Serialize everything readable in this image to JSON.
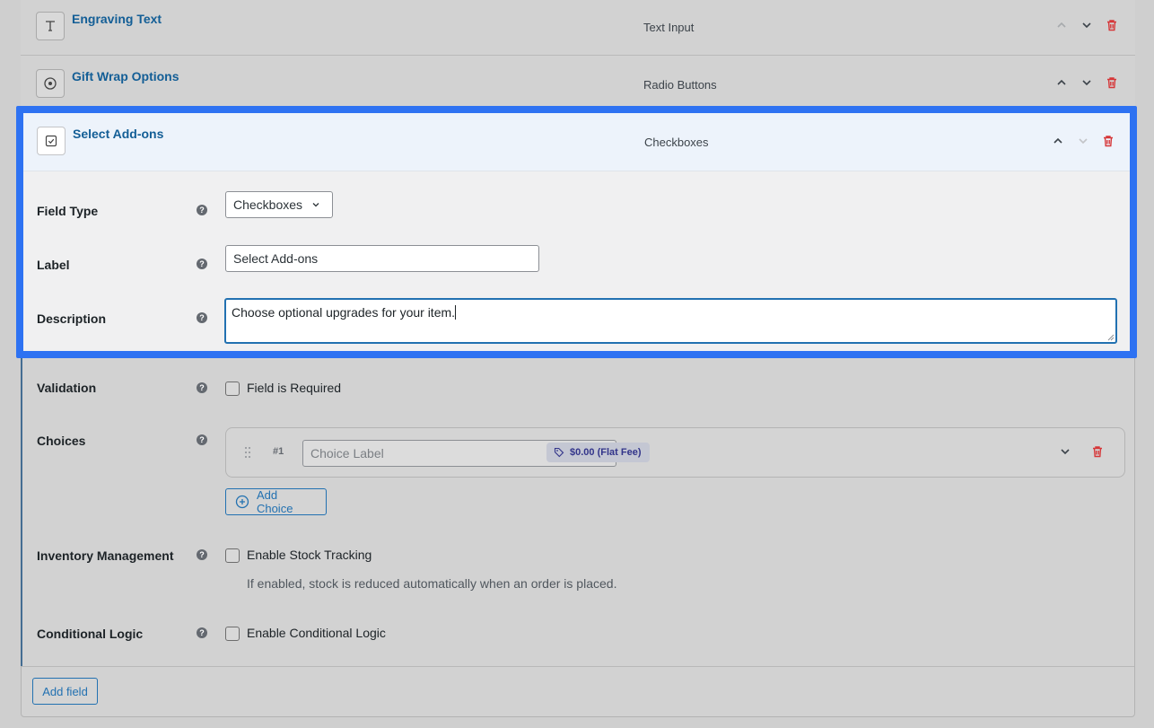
{
  "fields": [
    {
      "title": "Engraving Text",
      "type": "Text Input",
      "icon": "text-icon"
    },
    {
      "title": "Gift Wrap Options",
      "type": "Radio Buttons",
      "icon": "radio-icon"
    }
  ],
  "active_field": {
    "title": "Select Add-ons",
    "type": "Checkboxes",
    "icon": "checkbox-icon"
  },
  "form": {
    "field_type_label": "Field Type",
    "field_type_value": "Checkboxes",
    "label_label": "Label",
    "label_value": "Select Add-ons",
    "description_label": "Description",
    "description_value": "Choose optional upgrades for your item.",
    "validation_label": "Validation",
    "required_label": "Field is Required",
    "choices_label": "Choices",
    "choice_number": "#1",
    "choice_placeholder": "Choice Label",
    "choice_price": "$0.00 (Flat Fee)",
    "add_choice_label": "Add Choice",
    "inventory_label": "Inventory Management",
    "stock_label": "Enable Stock Tracking",
    "stock_help": "If enabled, stock is reduced automatically when an order is placed.",
    "conditional_label": "Conditional Logic",
    "conditional_toggle": "Enable Conditional Logic",
    "help_glyph": "?"
  },
  "footer": {
    "add_field_label": "Add field"
  },
  "colors": {
    "accent": "#2271b1",
    "highlight_border": "#2e72f2",
    "delete": "#d63638",
    "title": "#135e96"
  }
}
